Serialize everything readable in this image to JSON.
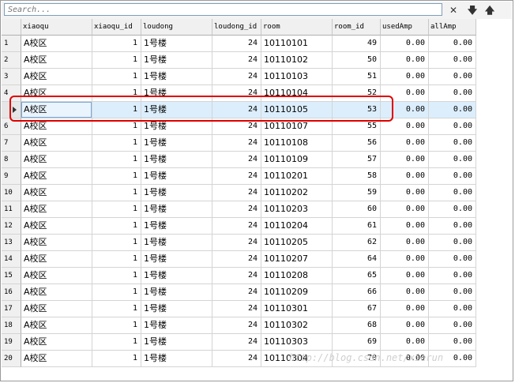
{
  "search": {
    "placeholder": "Search..."
  },
  "toolbar": {
    "close_glyph": "✕",
    "down_glyph": "🡇",
    "up_glyph": "🡅"
  },
  "columns": [
    "xiaoqu",
    "xiaoqu_id",
    "loudong",
    "loudong_id",
    "room",
    "room_id",
    "usedAmp",
    "allAmp"
  ],
  "rows": [
    [
      "1",
      "A校区",
      "1",
      "1号楼",
      "24",
      "10110101",
      "49",
      "0.00",
      "0.00"
    ],
    [
      "2",
      "A校区",
      "1",
      "1号楼",
      "24",
      "10110102",
      "50",
      "0.00",
      "0.00"
    ],
    [
      "3",
      "A校区",
      "1",
      "1号楼",
      "24",
      "10110103",
      "51",
      "0.00",
      "0.00"
    ],
    [
      "4",
      "A校区",
      "1",
      "1号楼",
      "24",
      "10110104",
      "52",
      "0.00",
      "0.00"
    ],
    [
      "5",
      "A校区",
      "1",
      "1号楼",
      "24",
      "10110105",
      "53",
      "0.00",
      "0.00"
    ],
    [
      "6",
      "A校区",
      "1",
      "1号楼",
      "24",
      "10110107",
      "55",
      "0.00",
      "0.00"
    ],
    [
      "7",
      "A校区",
      "1",
      "1号楼",
      "24",
      "10110108",
      "56",
      "0.00",
      "0.00"
    ],
    [
      "8",
      "A校区",
      "1",
      "1号楼",
      "24",
      "10110109",
      "57",
      "0.00",
      "0.00"
    ],
    [
      "9",
      "A校区",
      "1",
      "1号楼",
      "24",
      "10110201",
      "58",
      "0.00",
      "0.00"
    ],
    [
      "10",
      "A校区",
      "1",
      "1号楼",
      "24",
      "10110202",
      "59",
      "0.00",
      "0.00"
    ],
    [
      "11",
      "A校区",
      "1",
      "1号楼",
      "24",
      "10110203",
      "60",
      "0.00",
      "0.00"
    ],
    [
      "12",
      "A校区",
      "1",
      "1号楼",
      "24",
      "10110204",
      "61",
      "0.00",
      "0.00"
    ],
    [
      "13",
      "A校区",
      "1",
      "1号楼",
      "24",
      "10110205",
      "62",
      "0.00",
      "0.00"
    ],
    [
      "14",
      "A校区",
      "1",
      "1号楼",
      "24",
      "10110207",
      "64",
      "0.00",
      "0.00"
    ],
    [
      "15",
      "A校区",
      "1",
      "1号楼",
      "24",
      "10110208",
      "65",
      "0.00",
      "0.00"
    ],
    [
      "16",
      "A校区",
      "1",
      "1号楼",
      "24",
      "10110209",
      "66",
      "0.00",
      "0.00"
    ],
    [
      "17",
      "A校区",
      "1",
      "1号楼",
      "24",
      "10110301",
      "67",
      "0.00",
      "0.00"
    ],
    [
      "18",
      "A校区",
      "1",
      "1号楼",
      "24",
      "10110302",
      "68",
      "0.00",
      "0.00"
    ],
    [
      "19",
      "A校区",
      "1",
      "1号楼",
      "24",
      "10110303",
      "69",
      "0.00",
      "0.00"
    ],
    [
      "20",
      "A校区",
      "1",
      "1号楼",
      "24",
      "10110304",
      "70",
      "0.00",
      "0.00"
    ]
  ],
  "selected_row": "5",
  "watermark": "http://blog.csdn.net/xierun",
  "colors": {
    "highlight": "#e00000",
    "selection": "#dceefc"
  }
}
